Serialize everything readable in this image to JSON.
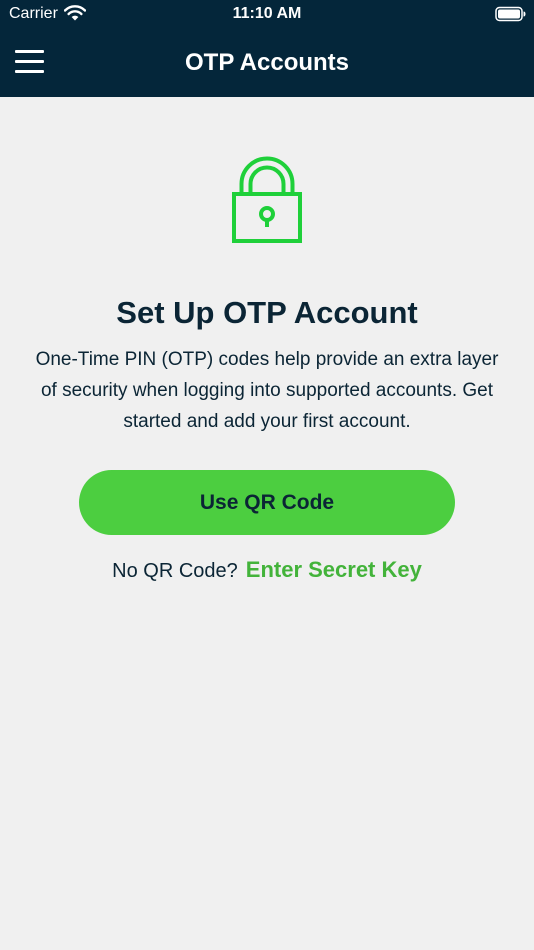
{
  "status_bar": {
    "carrier": "Carrier",
    "time": "11:10 AM",
    "wifi_icon": "wifi-icon",
    "battery_icon": "battery-icon"
  },
  "nav": {
    "title": "OTP Accounts",
    "menu_icon": "hamburger-menu-icon"
  },
  "main": {
    "icon": "lock-icon",
    "heading": "Set Up OTP Account",
    "description": "One-Time PIN (OTP) codes help provide an extra layer of security when logging into supported accounts. Get started and add your first account.",
    "primary_button": "Use QR Code",
    "alt_prompt": "No QR Code?",
    "alt_link": "Enter Secret Key"
  },
  "colors": {
    "header_bg": "#04263a",
    "page_bg": "#f0f0f0",
    "accent_green": "#4cce40",
    "link_green": "#43b33a",
    "lock_green": "#1fd03a",
    "text_dark": "#0b2535"
  }
}
